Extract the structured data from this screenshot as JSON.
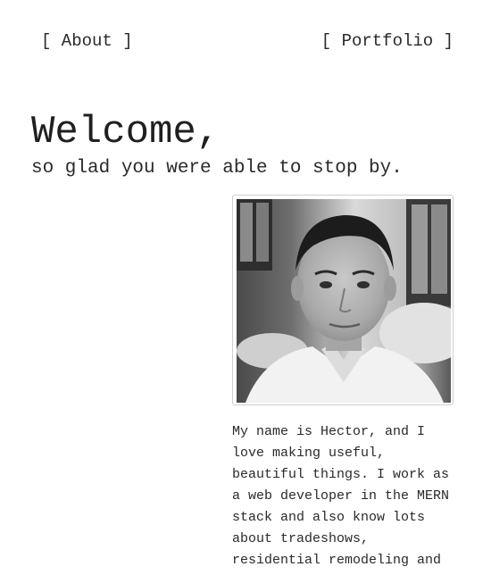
{
  "nav": {
    "about_label": "[ About ]",
    "portfolio_label": "[ Portfolio ]"
  },
  "hero": {
    "heading": "Welcome,",
    "subheading": "so glad you were able to stop by."
  },
  "bio": {
    "text": "My name is Hector, and I love making useful, beautiful things. I work as a web developer in the MERN stack and also know lots about tradeshows, residential remodeling and"
  },
  "colors": {
    "background": "#ffffff",
    "text": "#222222",
    "frame_border": "#cfcfcf"
  }
}
